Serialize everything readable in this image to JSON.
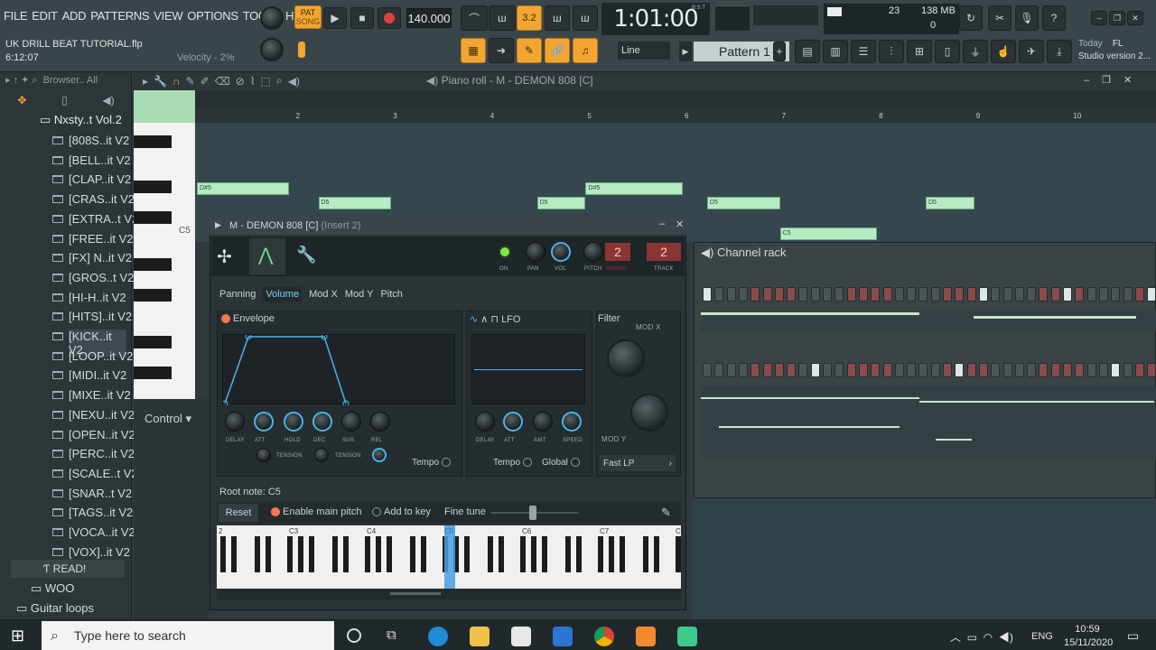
{
  "menu": [
    "FILE",
    "EDIT",
    "ADD",
    "PATTERNS",
    "VIEW",
    "OPTIONS",
    "TOOLS",
    "HELP"
  ],
  "transport": {
    "pat_label": "PAT",
    "song_label": "SONG",
    "tempo": "140.000",
    "time": "1:01:00",
    "time_format": "B:S:T",
    "step_label": "3.2"
  },
  "project": {
    "title": "UK DRILL BEAT TUTORIAL.flp",
    "elapsed": "6:12:07",
    "velocity_hint": "Velocity - 2%"
  },
  "monitor": {
    "cpu": "23",
    "memory": "138 MB",
    "polyphony": "0"
  },
  "snap": "Line",
  "pattern": "Pattern 1",
  "news": {
    "today": "Today",
    "fl": "FL",
    "studio": "Studio version 2..."
  },
  "browser": {
    "header": "Browser.. All",
    "root": "Nxsty..t Vol.2",
    "items": [
      "[808S..it V2",
      "[BELL..it V2",
      "[CLAP..it V2",
      "[CRAS..it V2",
      "[EXTRA..t V2",
      "[FREE..it V2",
      "[FX] N..it V2",
      "[GROS..t V2",
      "[HI-H..it V2",
      "[HITS]..it V2",
      "[KICK..it V2",
      "[LOOP..it V2",
      "[MIDI..it V2",
      "[MIXE..it V2",
      "[NEXU..it V2",
      "[OPEN..it V2",
      "[PERC..it V2",
      "[SCALE..t V2",
      "[SNAR..t V2",
      "[TAGS..it V2",
      "[VOCA..it V2",
      "[VOX]..it V2"
    ],
    "readme": "READ!",
    "woo": "WOO",
    "guitar": "Guitar loops"
  },
  "pianoroll": {
    "title": "Piano roll - M - DEMON 808 [C]",
    "bars": [
      "2",
      "3",
      "4",
      "5",
      "6",
      "7",
      "8",
      "9",
      "10"
    ],
    "c5_label": "C5",
    "control_label": "Control",
    "notes": [
      {
        "label": "D#5",
        "bar": 1.0,
        "len": 0.95,
        "row": 0
      },
      {
        "label": "D5",
        "bar": 2.25,
        "len": 0.75,
        "row": 1
      },
      {
        "label": "D5",
        "bar": 4.5,
        "len": 0.5,
        "row": 1
      },
      {
        "label": "D#5",
        "bar": 5.0,
        "len": 1.0,
        "row": 0
      },
      {
        "label": "D5",
        "bar": 6.25,
        "len": 0.75,
        "row": 1
      },
      {
        "label": "D5",
        "bar": 8.5,
        "len": 0.5,
        "row": 1
      },
      {
        "label": "C5",
        "bar": 7.0,
        "len": 1.0,
        "row": 2
      }
    ]
  },
  "channel": {
    "title": "M - DEMON 808 [C]",
    "insert": "(Insert 2)",
    "on": "ON",
    "pan": "PAN",
    "vol": "VOL",
    "pitch": "PITCH",
    "range": "RANGE",
    "track": "TRACK",
    "range_val": "2",
    "track_val": "2",
    "tabs": [
      "Panning",
      "Volume",
      "Mod X",
      "Mod Y",
      "Pitch"
    ],
    "envelope": "Envelope",
    "lfo": "LFO",
    "filter": "Filter",
    "mod_x": "MOD X",
    "mod_y": "MOD Y",
    "filter_type": "Fast LP",
    "env_knobs": [
      "DELAY",
      "ATT",
      "HOLD",
      "DEC",
      "SUS",
      "REL"
    ],
    "tension": "TENSION",
    "lfo_knobs": [
      "DELAY",
      "ATT",
      "AMT",
      "SPEED"
    ],
    "tempo": "Tempo",
    "global": "Global",
    "root_note": "Root note: C5",
    "reset": "Reset",
    "enable_main_pitch": "Enable main pitch",
    "add_to_key": "Add to key",
    "fine_tune": "Fine tune",
    "octaves": [
      "2",
      "C3",
      "C4",
      "C5",
      "C6",
      "C7",
      "C"
    ]
  },
  "channel_rack": {
    "title": "Channel rack"
  },
  "taskbar": {
    "search_placeholder": "Type here to search",
    "lang": "ENG",
    "time": "10:59",
    "date": "15/11/2020"
  },
  "colors": {
    "accent_orange": "#f2a531",
    "note_green": "#b7ebc4",
    "knob_blue": "#4ab4e8",
    "record_red": "#e0403a"
  }
}
